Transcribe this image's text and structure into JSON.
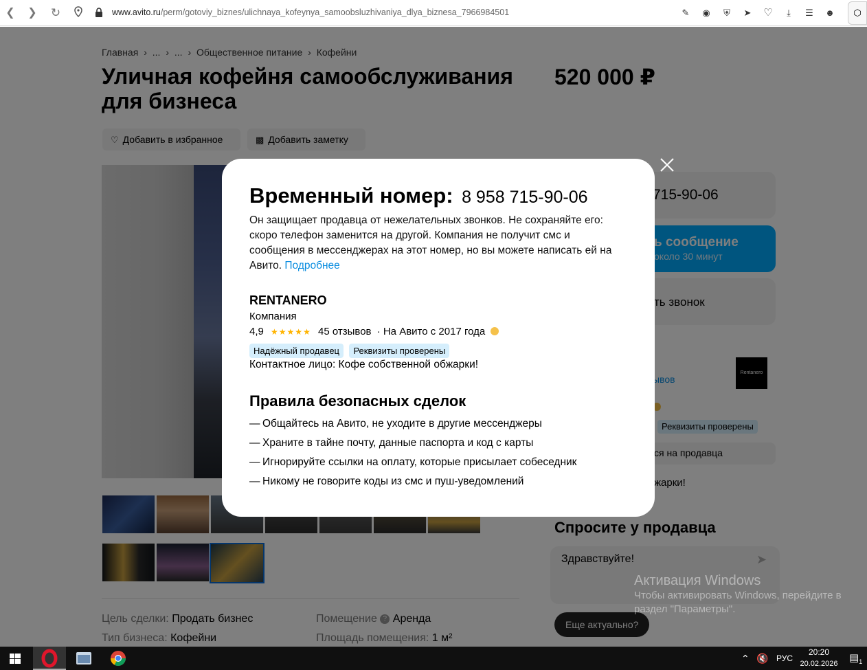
{
  "browser": {
    "url_domain": "www.avito.ru",
    "url_path": "/perm/gotoviy_biznes/ulichnaya_kofeynya_samoobsluzhivaniya_dlya_biznesa_7966984501"
  },
  "breadcrumb": [
    "Главная",
    "›",
    "...",
    "›",
    "...",
    "›",
    "Общественное питание",
    "›",
    "Кофейни"
  ],
  "listing": {
    "title": "Уличная кофейня самообслуживания для бизнеса",
    "price": "520 000 ₽",
    "fav_label": "Добавить в избранное",
    "note_label": "Добавить заметку"
  },
  "params": [
    {
      "key": "Цель сделки:",
      "value": "Продать бизнес"
    },
    {
      "key": "Помещение",
      "value": "Аренда"
    },
    {
      "key": "Тип бизнеса:",
      "value": "Кофейни"
    },
    {
      "key": "Площадь помещения:",
      "value": "1 м²"
    }
  ],
  "right": {
    "phone_partial": "715-90-06",
    "message_title_partial": "ь сообщение",
    "message_sub_partial": "около 30 минут",
    "call_partial": "ть звонок",
    "reviews_partial": "ывов",
    "logo_text": "Rentanero",
    "badge_partial": "Реквизиты проверены",
    "complain_partial": "ся на продавца",
    "contact_partial": "жарки!",
    "ask_title": "Спросите у продавца",
    "ask_input": "Здравствуйте!",
    "ask_chip": "Еще актуально?"
  },
  "modal": {
    "label": "Временный номер:",
    "number": "8 958 715-90-06",
    "description": "Он защищает продавца от нежелательных звонков. Не сохраняйте его: скоро телефон заменится на другой. Компания не получит смс и сообщения в мессенджерах на этот номер, но вы можете написать ей на Авито.",
    "more_link": "Подробнее",
    "seller_name": "RENTANERO",
    "seller_type": "Компания",
    "rating": "4,9",
    "stars": "★★★★★",
    "reviews": "45 отзывов",
    "since": "· На Авито с 2017 года",
    "badges": [
      "Надёжный продавец",
      "Реквизиты проверены"
    ],
    "contact": "Контактное лицо: Кофе собственной обжарки!",
    "rules_title": "Правила безопасных сделок",
    "rules": [
      "Общайтесь на Авито, не уходите в другие мессенджеры",
      "Храните в тайне почту, данные паспорта и код с карты",
      "Игнорируйте ссылки на оплату, которые присылает собеседник",
      "Никому не говорите коды из смс и пуш-уведомлений"
    ]
  },
  "watermark": {
    "title": "Активация Windows",
    "line1": "Чтобы активировать Windows, перейдите в",
    "line2": "раздел \"Параметры\"."
  },
  "taskbar": {
    "lang": "РУС",
    "time": "20:20",
    "date": "20.02.2026",
    "notif_count": "1"
  }
}
